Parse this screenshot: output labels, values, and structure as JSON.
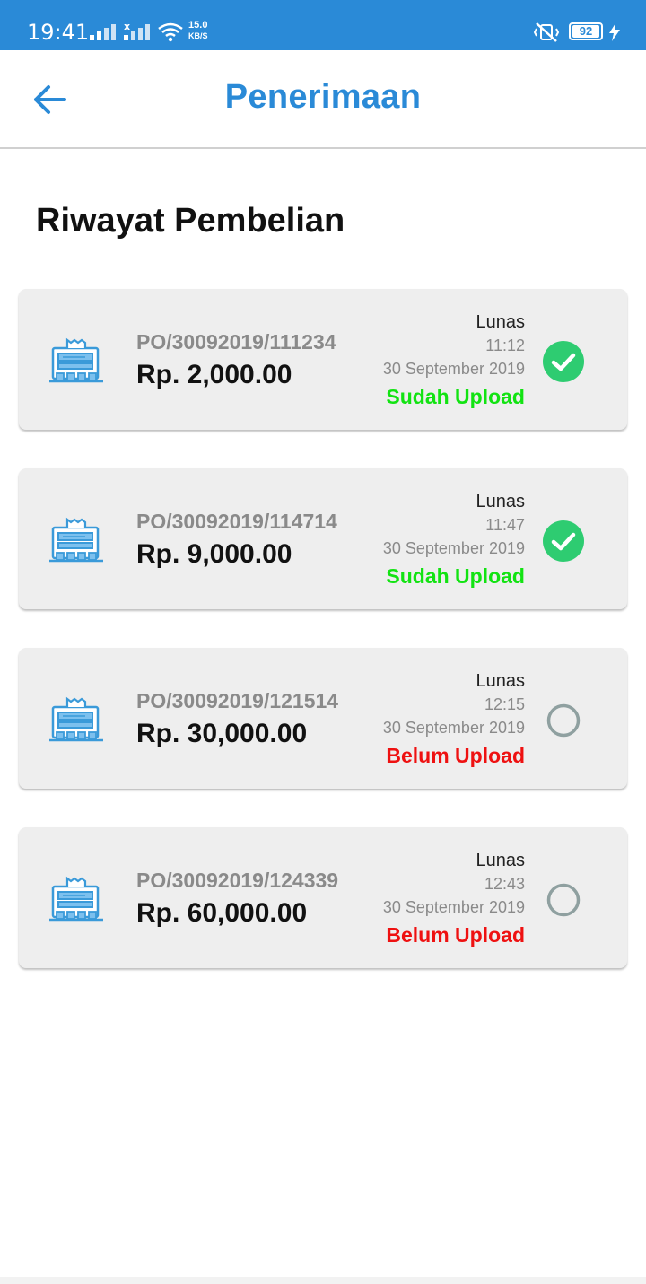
{
  "status_bar": {
    "time": "19:41",
    "net_speed_value": "15.0",
    "net_speed_unit": "KB/S",
    "battery": "92"
  },
  "app_bar": {
    "title": "Penerimaan",
    "back_icon": "arrow-left-icon"
  },
  "section_title": "Riwayat Pembelian",
  "colors": {
    "brand": "#2a8ad7",
    "uploaded": "#12e312",
    "not_uploaded": "#ee1111",
    "check_fill": "#2ecc71",
    "pending_ring": "#8fa0a0"
  },
  "purchases": [
    {
      "po_number": "PO/30092019/111234",
      "amount": "Rp. 2,000.00",
      "payment_status": "Lunas",
      "time": "11:12",
      "date": "30 September 2019",
      "upload_status": "Sudah Upload",
      "uploaded": true
    },
    {
      "po_number": "PO/30092019/114714",
      "amount": "Rp. 9,000.00",
      "payment_status": "Lunas",
      "time": "11:47",
      "date": "30 September 2019",
      "upload_status": "Sudah Upload",
      "uploaded": true
    },
    {
      "po_number": "PO/30092019/121514",
      "amount": "Rp. 30,000.00",
      "payment_status": "Lunas",
      "time": "12:15",
      "date": "30 September 2019",
      "upload_status": "Belum Upload",
      "uploaded": false
    },
    {
      "po_number": "PO/30092019/124339",
      "amount": "Rp. 60,000.00",
      "payment_status": "Lunas",
      "time": "12:43",
      "date": "30 September 2019",
      "upload_status": "Belum Upload",
      "uploaded": false
    }
  ]
}
